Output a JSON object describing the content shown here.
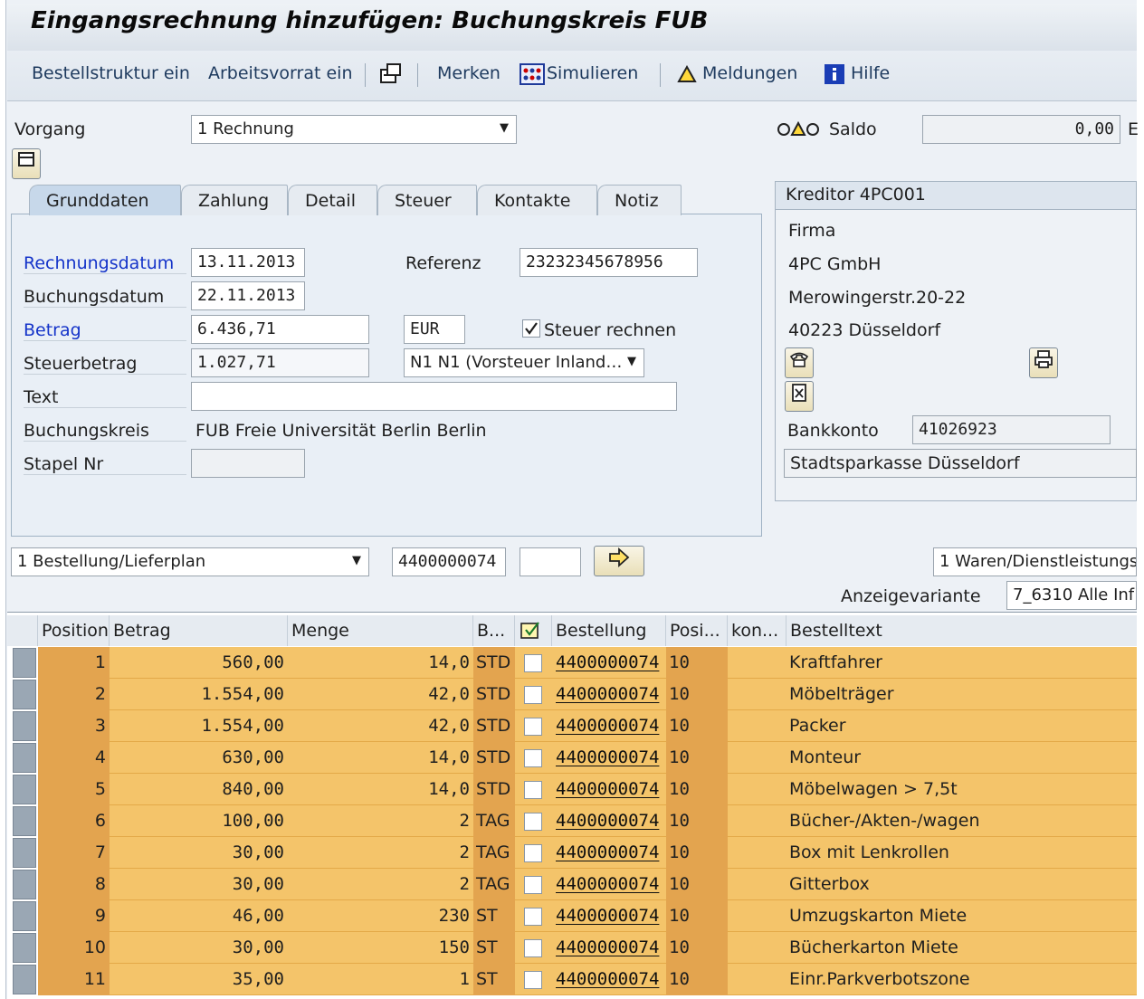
{
  "window": {
    "title": "Eingangsrechnung hinzufügen: Buchungskreis FUB"
  },
  "toolbar": {
    "bestellstruktur": "Bestellstruktur ein",
    "arbeitsvorrat": "Arbeitsvorrat ein",
    "merken": "Merken",
    "simulieren": "Simulieren",
    "meldungen": "Meldungen",
    "hilfe": "Hilfe"
  },
  "vorgang": {
    "label": "Vorgang",
    "value": "1 Rechnung"
  },
  "saldo": {
    "label": "Saldo",
    "value": "0,00",
    "trailing": "E"
  },
  "tabs": [
    {
      "label": "Grunddaten"
    },
    {
      "label": "Zahlung"
    },
    {
      "label": "Detail"
    },
    {
      "label": "Steuer"
    },
    {
      "label": "Kontakte"
    },
    {
      "label": "Notiz"
    }
  ],
  "grunddaten": {
    "rechnungsdatum_label": "Rechnungsdatum",
    "rechnungsdatum": "13.11.2013",
    "buchungsdatum_label": "Buchungsdatum",
    "buchungsdatum": "22.11.2013",
    "betrag_label": "Betrag",
    "betrag": "6.436,71",
    "waehrung": "EUR",
    "steuerbetrag_label": "Steuerbetrag",
    "steuerbetrag": "1.027,71",
    "steuerkz": "N1 N1 (Vorsteuer Inland…",
    "text_label": "Text",
    "text": "",
    "buchungskreis_label": "Buchungskreis",
    "buchungskreis": "FUB Freie Universität Berlin Berlin",
    "stapel_label": "Stapel Nr",
    "stapel": "",
    "referenz_label": "Referenz",
    "referenz": "23232345678956",
    "steuer_rechnen": "Steuer rechnen"
  },
  "kreditor": {
    "header": "Kreditor 4PC001",
    "anrede": "Firma",
    "name": "4PC GmbH",
    "strasse": "Merowingerstr.20-22",
    "ort": "40223 Düsseldorf",
    "bankkonto_label": "Bankkonto",
    "bankkonto": "41026923",
    "bank": "Stadtsparkasse Düsseldorf"
  },
  "bezug": {
    "typ": "1 Bestellung/Lieferplan",
    "nummer": "4400000074",
    "zusatz": "",
    "art": "1 Waren/Dienstleistungs",
    "anzeigevariante_label": "Anzeigevariante",
    "anzeigevariante": "7_6310 Alle Inf"
  },
  "table": {
    "headers": [
      "Position",
      "Betrag",
      "Menge",
      "B...",
      "",
      "Bestellung",
      "Posi...",
      "kon...",
      "Bestelltext"
    ],
    "rows": [
      {
        "pos": "1",
        "betrag": "560,00",
        "menge": "14,0",
        "einheit": "STD",
        "bestellung": "4400000074",
        "posi": "10",
        "text": "Kraftfahrer"
      },
      {
        "pos": "2",
        "betrag": "1.554,00",
        "menge": "42,0",
        "einheit": "STD",
        "bestellung": "4400000074",
        "posi": "10",
        "text": "Möbelträger"
      },
      {
        "pos": "3",
        "betrag": "1.554,00",
        "menge": "42,0",
        "einheit": "STD",
        "bestellung": "4400000074",
        "posi": "10",
        "text": "Packer"
      },
      {
        "pos": "4",
        "betrag": "630,00",
        "menge": "14,0",
        "einheit": "STD",
        "bestellung": "4400000074",
        "posi": "10",
        "text": "Monteur"
      },
      {
        "pos": "5",
        "betrag": "840,00",
        "menge": "14,0",
        "einheit": "STD",
        "bestellung": "4400000074",
        "posi": "10",
        "text": "Möbelwagen > 7,5t"
      },
      {
        "pos": "6",
        "betrag": "100,00",
        "menge": "2",
        "einheit": "TAG",
        "bestellung": "4400000074",
        "posi": "10",
        "text": "Bücher-/Akten-/wagen"
      },
      {
        "pos": "7",
        "betrag": "30,00",
        "menge": "2",
        "einheit": "TAG",
        "bestellung": "4400000074",
        "posi": "10",
        "text": "Box mit Lenkrollen"
      },
      {
        "pos": "8",
        "betrag": "30,00",
        "menge": "2",
        "einheit": "TAG",
        "bestellung": "4400000074",
        "posi": "10",
        "text": "Gitterbox"
      },
      {
        "pos": "9",
        "betrag": "46,00",
        "menge": "230",
        "einheit": "ST",
        "bestellung": "4400000074",
        "posi": "10",
        "text": "Umzugskarton Miete"
      },
      {
        "pos": "10",
        "betrag": "30,00",
        "menge": "150",
        "einheit": "ST",
        "bestellung": "4400000074",
        "posi": "10",
        "text": "Bücherkarton Miete"
      },
      {
        "pos": "11",
        "betrag": "35,00",
        "menge": "1",
        "einheit": "ST",
        "bestellung": "4400000074",
        "posi": "10",
        "text": "Einr.Parkverbotszone"
      }
    ]
  },
  "colors": {
    "row_bg": "#f4c46a",
    "row_dark": "#e3a44f",
    "link": "#1534c9"
  }
}
